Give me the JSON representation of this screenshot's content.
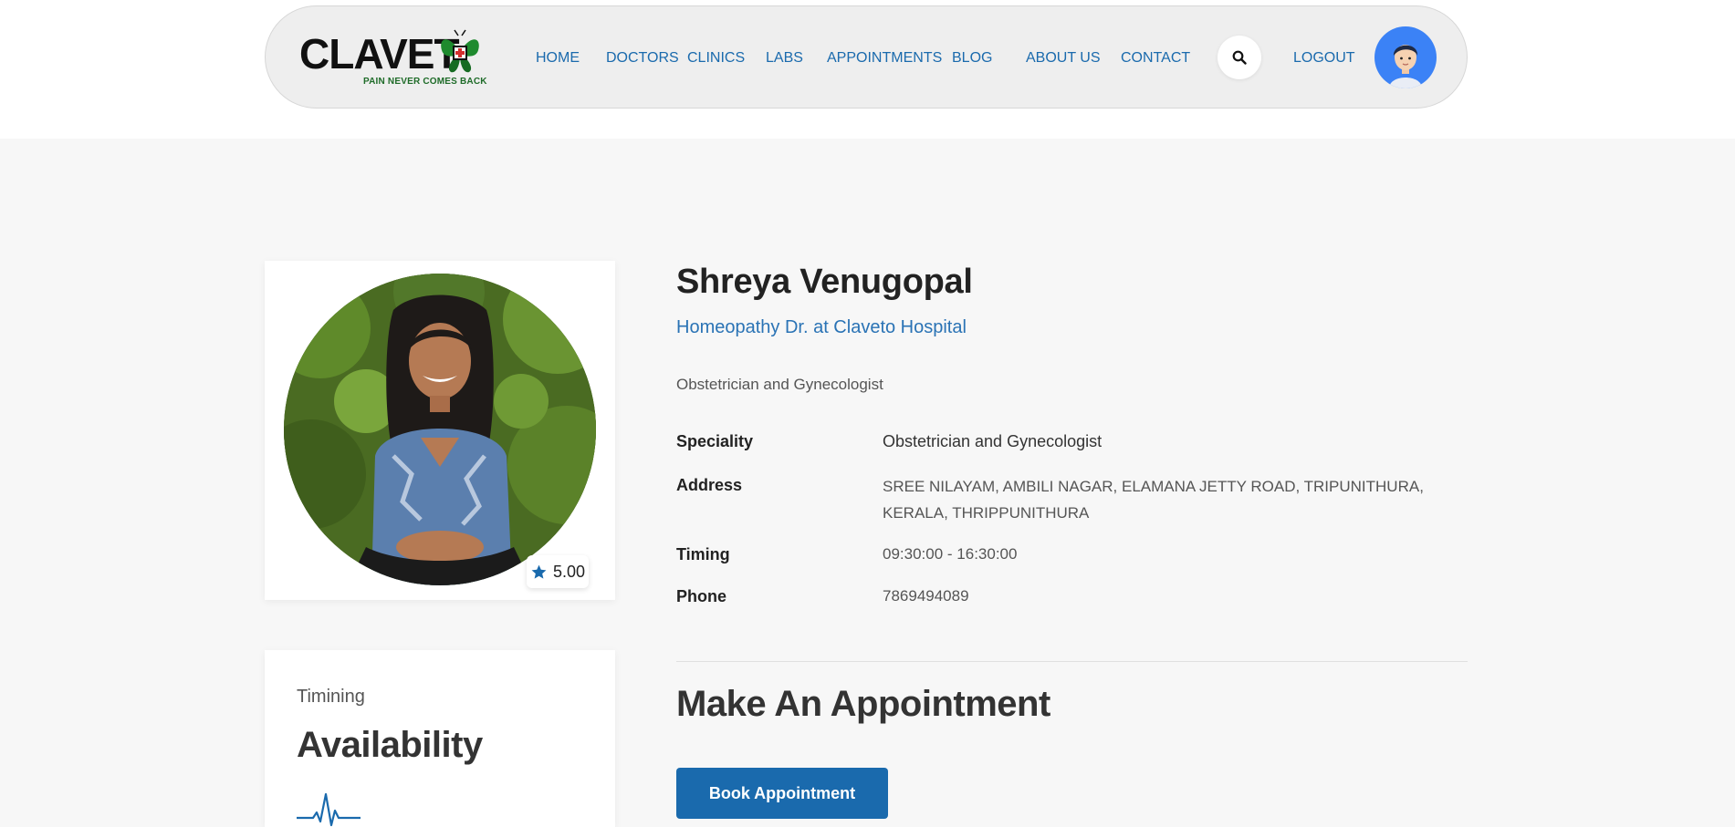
{
  "header": {
    "logo": {
      "text": "CLAVET",
      "tagline": "PAIN NEVER COMES BACK",
      "icon": "butterfly-cross-icon"
    },
    "nav": [
      {
        "label": "HOME"
      },
      {
        "label": "DOCTORS"
      },
      {
        "label": "CLINICS"
      },
      {
        "label": "LABS"
      },
      {
        "label": "APPOINTMENTS"
      },
      {
        "label": "BLOG"
      },
      {
        "label": "ABOUT US"
      },
      {
        "label": "CONTACT"
      }
    ],
    "search_icon": "search-icon",
    "logout_label": "LOGOUT",
    "avatar_icon": "user-avatar-icon"
  },
  "profile": {
    "rating": "5.00",
    "rating_icon": "star-icon",
    "name": "Shreya Venugopal",
    "role": "Homeopathy Dr. at Claveto Hospital",
    "description": "Obstetrician and Gynecologist",
    "details": {
      "speciality_label": "Speciality",
      "speciality_value": "Obstetrician and Gynecologist",
      "address_label": "Address",
      "address_value": "SREE NILAYAM, AMBILI NAGAR, ELAMANA JETTY ROAD, TRIPUNITHURA, KERALA, THRIPPUNITHURA",
      "timing_label": "Timing",
      "timing_value": "09:30:00 - 16:30:00",
      "phone_label": "Phone",
      "phone_value": "7869494089"
    }
  },
  "availability": {
    "subtitle": "Timining",
    "title": "Availability",
    "icon": "heartbeat-pulse-icon"
  },
  "appointment": {
    "title": "Make An Appointment",
    "button_label": "Book Appointment"
  },
  "colors": {
    "accent": "#1a6aad",
    "role_text": "#2a73b5",
    "avatar_bg": "#3b82f6"
  }
}
